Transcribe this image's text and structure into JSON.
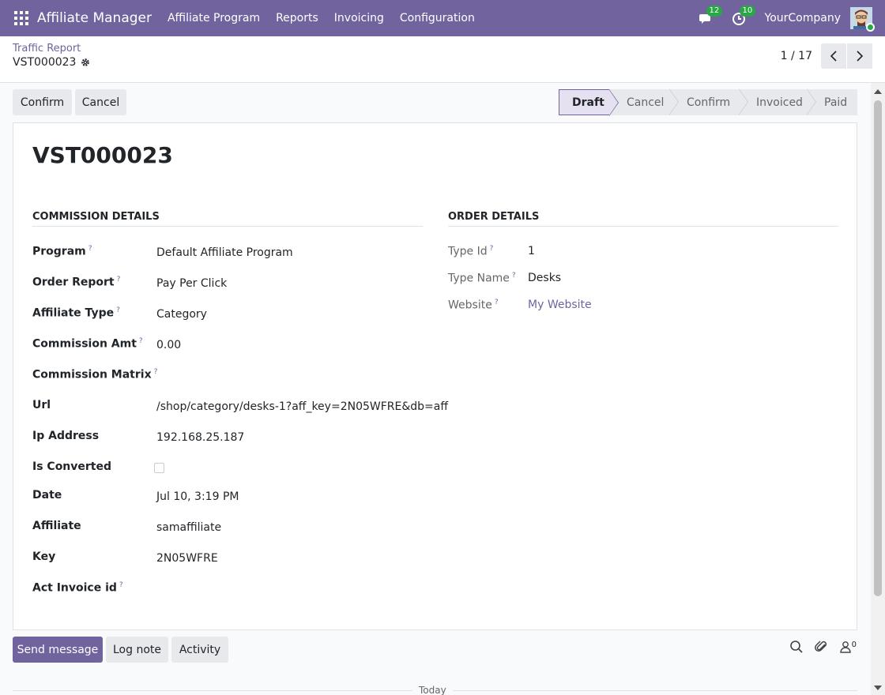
{
  "navbar": {
    "app_name": "Affiliate Manager",
    "menus": [
      "Affiliate Program",
      "Reports",
      "Invoicing",
      "Configuration"
    ],
    "messages_count": "12",
    "activities_count": "10",
    "company": "YourCompany"
  },
  "breadcrumb": {
    "parent": "Traffic Report",
    "current": "VST000023"
  },
  "pager": {
    "value": "1 / 17"
  },
  "actions": {
    "confirm": "Confirm",
    "cancel": "Cancel"
  },
  "statusbar": {
    "stages": [
      "Draft",
      "Cancel",
      "Confirm",
      "Invoiced",
      "Paid"
    ],
    "active": "Draft"
  },
  "record": {
    "title": "VST000023",
    "commission_section": "COMMISSION DETAILS",
    "order_section": "ORDER DETAILS",
    "fields": {
      "program": {
        "label": "Program",
        "value": "Default Affiliate Program"
      },
      "order_report": {
        "label": "Order Report",
        "value": "Pay Per Click"
      },
      "affiliate_type": {
        "label": "Affiliate Type",
        "value": "Category"
      },
      "commission_amt": {
        "label": "Commission Amt",
        "value": "0.00"
      },
      "commission_matrix": {
        "label": "Commission Matrix",
        "value": ""
      },
      "url": {
        "label": "Url",
        "value": "/shop/category/desks-1?aff_key=2N05WFRE&db=aff"
      },
      "ip_address": {
        "label": "Ip Address",
        "value": "192.168.25.187"
      },
      "is_converted": {
        "label": "Is Converted",
        "checked": false
      },
      "date": {
        "label": "Date",
        "value": "Jul 10, 3:19 PM"
      },
      "affiliate": {
        "label": "Affiliate",
        "value": "samaffiliate"
      },
      "key": {
        "label": "Key",
        "value": "2N05WFRE"
      },
      "act_invoice_id": {
        "label": "Act Invoice id",
        "value": ""
      }
    },
    "order": {
      "type_id": {
        "label": "Type Id",
        "value": "1"
      },
      "type_name": {
        "label": "Type Name",
        "value": "Desks"
      },
      "website": {
        "label": "Website",
        "value": "My Website"
      }
    }
  },
  "chatter": {
    "send_message": "Send message",
    "log_note": "Log note",
    "activity": "Activity",
    "followers_count": "0",
    "today": "Today"
  },
  "colors": {
    "brand": "#71639e",
    "badge": "#28a745"
  }
}
